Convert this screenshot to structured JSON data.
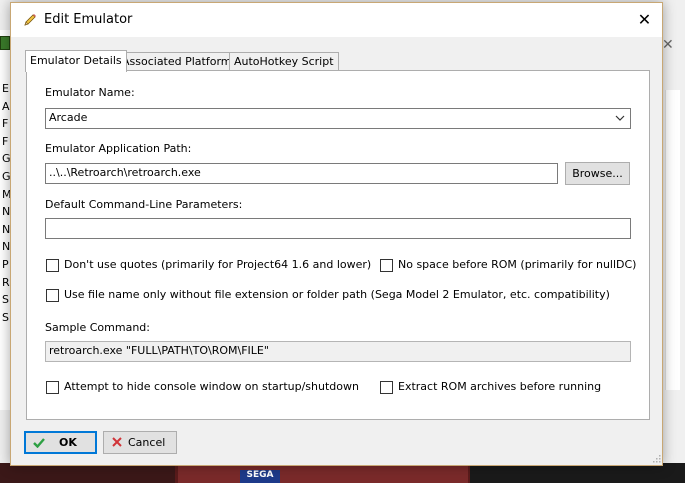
{
  "dialog": {
    "title": "Edit Emulator",
    "close_glyph": "✕"
  },
  "tabs": [
    {
      "label": "Emulator Details",
      "active": true
    },
    {
      "label": "Associated Platforms",
      "active": false
    },
    {
      "label": "AutoHotkey Script",
      "active": false
    }
  ],
  "form": {
    "emulator_name_label": "Emulator Name:",
    "emulator_name_value": "Arcade",
    "app_path_label": "Emulator Application Path:",
    "app_path_value": "..\\..\\Retroarch\\retroarch.exe",
    "browse_label": "Browse...",
    "cmdline_label": "Default Command-Line Parameters:",
    "cmdline_value": "",
    "no_quotes_label": "Don't use quotes (primarily for Project64 1.6 and lower)",
    "no_space_label": "No space before ROM (primarily for nullDC)",
    "filename_only_label": "Use file name only without file extension or folder path (Sega Model 2 Emulator, etc. compatibility)",
    "sample_command_label": "Sample Command:",
    "sample_command_value": "retroarch.exe \"FULL\\PATH\\TO\\ROM\\FILE\"",
    "hide_console_label": "Attempt to hide console window on startup/shutdown",
    "extract_rom_label": "Extract ROM archives before running",
    "checks": {
      "no_quotes": false,
      "no_space": false,
      "filename_only": false,
      "hide_console": false,
      "extract_rom": false
    }
  },
  "footer": {
    "ok_label": "OK",
    "cancel_label": "Cancel"
  },
  "background": {
    "left_letters": [
      "E",
      "A",
      "F",
      "F",
      "G",
      "G",
      "M",
      "N",
      "N",
      "N",
      "P",
      "R",
      "S",
      "S"
    ],
    "tile_text": "SEGA",
    "close_glyph": "✕"
  },
  "colors": {
    "accent": "#0078d7",
    "ok_check": "#2ea043",
    "cancel_x": "#d13438"
  }
}
